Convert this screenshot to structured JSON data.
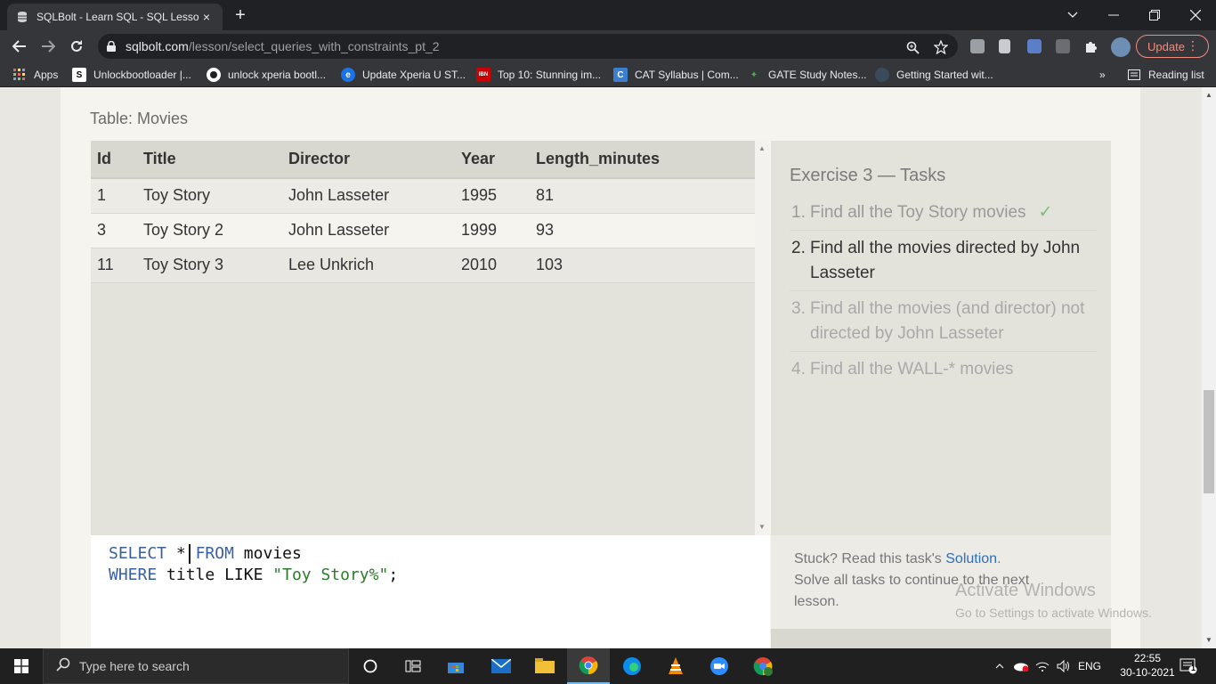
{
  "browser": {
    "tab": {
      "title": "SQLBolt - Learn SQL - SQL Lesson",
      "close": "×"
    },
    "new_tab": "+",
    "url": {
      "host": "sqlbolt.com",
      "path": "/lesson/select_queries_with_constraints_pt_2"
    },
    "update_label": "Update",
    "bookmarks": [
      {
        "label": "Apps",
        "icon": "apps-grid-icon"
      },
      {
        "label": "Unlockbootloader |...",
        "icon": "s-logo-icon"
      },
      {
        "label": "unlock xperia bootl...",
        "icon": "github-icon"
      },
      {
        "label": "Update Xperia U ST...",
        "icon": "edge-icon"
      },
      {
        "label": "Top 10: Stunning im...",
        "icon": "ibn-icon"
      },
      {
        "label": "CAT Syllabus | Com...",
        "icon": "c-logo-icon"
      },
      {
        "label": "GATE Study Notes...",
        "icon": "leaf-icon"
      },
      {
        "label": "Getting Started wit...",
        "icon": "globe-icon"
      }
    ],
    "bookmarks_more": "»",
    "reading_list": "Reading list"
  },
  "page": {
    "table_caption": "Table: Movies",
    "table": {
      "headers": [
        "Id",
        "Title",
        "Director",
        "Year",
        "Length_minutes"
      ],
      "rows": [
        [
          "1",
          "Toy Story",
          "John Lasseter",
          "1995",
          "81"
        ],
        [
          "3",
          "Toy Story 2",
          "John Lasseter",
          "1999",
          "93"
        ],
        [
          "11",
          "Toy Story 3",
          "Lee Unkrich",
          "2010",
          "103"
        ]
      ]
    },
    "query": {
      "line1": {
        "kw1": "SELECT",
        "star": "*",
        "kw2": "FROM",
        "table": "movies"
      },
      "line2": {
        "kw1": "WHERE",
        "col": "title",
        "op": "LIKE",
        "str": "\"Toy Story%\"",
        "end": ";"
      }
    },
    "tasks": {
      "heading": "Exercise 3 — Tasks",
      "items": [
        {
          "num": "1.",
          "text": "Find all the Toy Story movies",
          "status": "done",
          "mark": "✓"
        },
        {
          "num": "2.",
          "text": "Find all the movies directed by John Lasseter",
          "status": "active"
        },
        {
          "num": "3.",
          "text": "Find all the movies (and director) not directed by John Lasseter",
          "status": "todo"
        },
        {
          "num": "4.",
          "text": "Find all the WALL-* movies",
          "status": "todo"
        }
      ]
    },
    "help": {
      "prefix": "Stuck? Read this task's ",
      "link": "Solution",
      "suffix": ".",
      "line2": "Solve all tasks to continue to the next lesson."
    },
    "watermark": {
      "line1": "Activate Windows",
      "line2": "Go to Settings to activate Windows."
    }
  },
  "taskbar": {
    "search_placeholder": "Type here to search",
    "lang": "ENG",
    "time": "22:55",
    "date": "30-10-2021",
    "notification_count": "1"
  },
  "colors": {
    "link": "#2f6fbf",
    "keyword": "#3a5f9e",
    "string": "#2c7a2c",
    "check": "#7cbd7c",
    "update": "#f28b82"
  }
}
